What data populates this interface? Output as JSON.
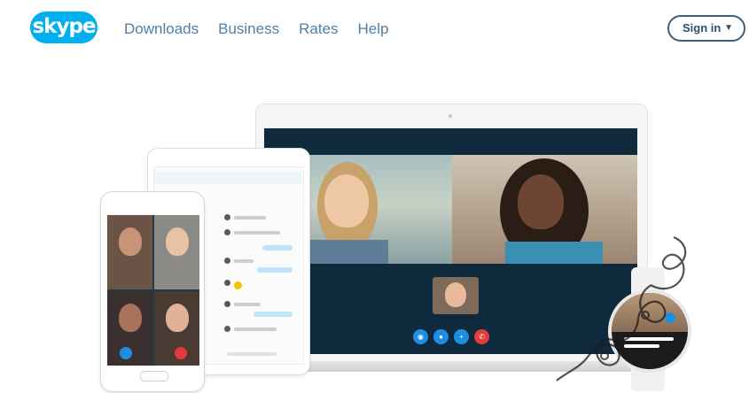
{
  "brand": {
    "logo_text": "skype",
    "color": "#00aff0"
  },
  "nav": {
    "items": [
      {
        "label": "Downloads"
      },
      {
        "label": "Business"
      },
      {
        "label": "Rates"
      },
      {
        "label": "Help"
      }
    ]
  },
  "header": {
    "signin_label": "Sign in",
    "signin_icon": "chevron-down-icon"
  },
  "hero": {
    "devices": [
      "laptop",
      "tablet",
      "phone",
      "smartwatch"
    ],
    "call_controls": [
      {
        "icon": "video-icon",
        "glyph": "◉"
      },
      {
        "icon": "mic-icon",
        "glyph": "●"
      },
      {
        "icon": "plus-icon",
        "glyph": "+"
      },
      {
        "icon": "end-call-icon",
        "glyph": "✆"
      }
    ]
  },
  "colors": {
    "nav_link": "#4f7fa6",
    "dark_screen": "#0f2a3d",
    "end_call": "#e23b3b"
  }
}
